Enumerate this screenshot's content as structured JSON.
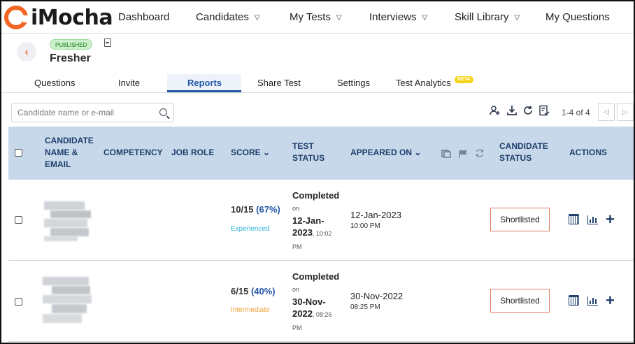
{
  "brand": {
    "name": "iMocha",
    "accent": "#f26522"
  },
  "nav": {
    "items": [
      {
        "label": "Dashboard",
        "caret": false
      },
      {
        "label": "Candidates",
        "caret": true
      },
      {
        "label": "My Tests",
        "caret": true
      },
      {
        "label": "Interviews",
        "caret": true
      },
      {
        "label": "Skill Library",
        "caret": true
      },
      {
        "label": "My Questions",
        "caret": false
      }
    ],
    "caret_glyph": "▽"
  },
  "test": {
    "status_badge": "PUBLISHED",
    "title": "Fresher",
    "back_glyph": "‹"
  },
  "tabs": {
    "items": [
      "Questions",
      "Invite",
      "Reports",
      "Share Test",
      "Settings",
      "Test Analytics"
    ],
    "active": "Reports",
    "beta_label": "BETA"
  },
  "search": {
    "placeholder": "Candidate name or e-mail",
    "value": ""
  },
  "toolbar": {
    "icons": [
      "add-candidate-icon",
      "download-icon",
      "refresh-icon",
      "report-icon"
    ],
    "pagination": "1-4 of 4",
    "prev_glyph": "◁",
    "next_glyph": "▷"
  },
  "table": {
    "headers": {
      "candidate": "CANDIDATE NAME & EMAIL",
      "competency": "COMPETENCY",
      "job_role": "JOB ROLE",
      "score": "SCORE",
      "test_status": "TEST STATUS",
      "appeared_on": "APPEARED ON",
      "candidate_status": "CANDIDATE STATUS",
      "actions": "ACTIONS"
    },
    "sort_glyph": "⌄",
    "rows": [
      {
        "score": "10/15",
        "percent": "(67%)",
        "level": "Experienced",
        "level_color": "#2bb3d6",
        "test_status": "Completed",
        "on_label": "on",
        "completed_date": "12-Jan-",
        "completed_year": "2023",
        "completed_time": ", 10:02",
        "completed_ampm": "PM",
        "appeared_date": "12-Jan-2023",
        "appeared_time": "10:00 PM",
        "candidate_status": "Shortlisted"
      },
      {
        "score": "6/15",
        "percent": "(40%)",
        "level": "Intermediate",
        "level_color": "#f0a23a",
        "test_status": "Completed",
        "on_label": "on",
        "completed_date": "30-Nov-",
        "completed_year": "2022",
        "completed_time": ", 08:26",
        "completed_ampm": "PM",
        "appeared_date": "30-Nov-2022",
        "appeared_time": "08:25 PM",
        "candidate_status": "Shortlisted"
      }
    ],
    "plus_glyph": "+"
  }
}
